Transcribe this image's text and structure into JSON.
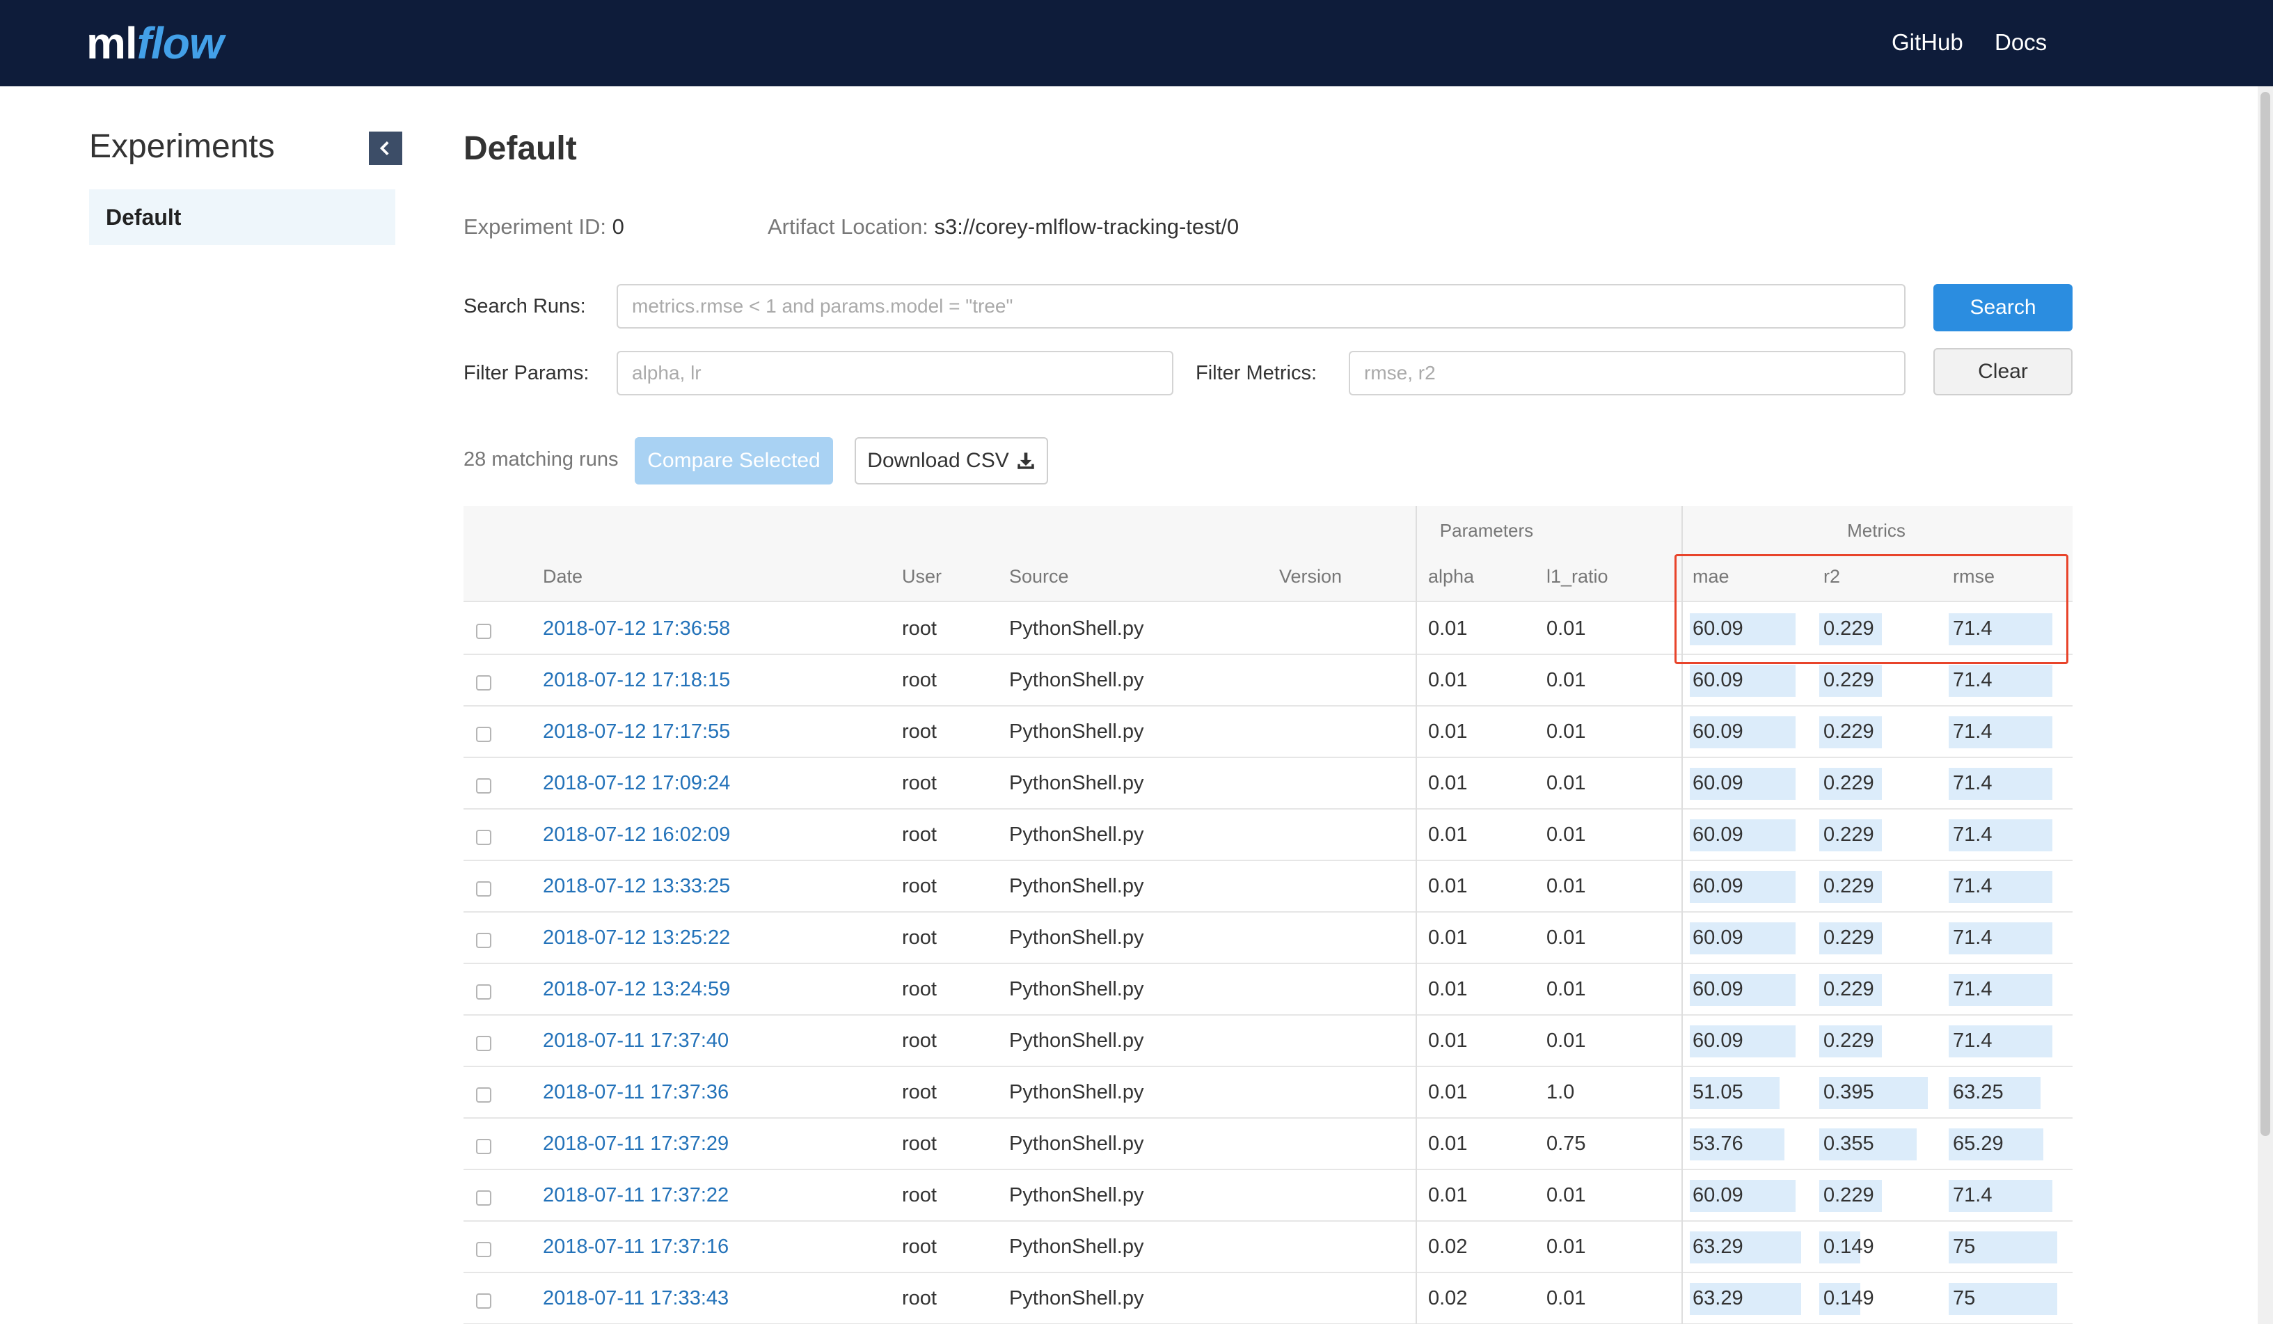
{
  "header": {
    "logo_ml": "ml",
    "logo_flow": "flow",
    "github_label": "GitHub",
    "docs_label": "Docs"
  },
  "sidebar": {
    "title": "Experiments",
    "items": [
      {
        "label": "Default"
      }
    ]
  },
  "main": {
    "title": "Default",
    "experiment_id_label": "Experiment ID:",
    "experiment_id": "0",
    "artifact_location_label": "Artifact Location:",
    "artifact_location": "s3://corey-mlflow-tracking-test/0",
    "search_runs_label": "Search Runs:",
    "search_runs_placeholder": "metrics.rmse < 1 and params.model = \"tree\"",
    "search_button": "Search",
    "filter_params_label": "Filter Params:",
    "filter_params_placeholder": "alpha, lr",
    "filter_metrics_label": "Filter Metrics:",
    "filter_metrics_placeholder": "rmse, r2",
    "clear_button": "Clear",
    "matching_runs": "28 matching runs",
    "compare_button": "Compare Selected",
    "download_button": "Download CSV"
  },
  "table": {
    "group_parameters": "Parameters",
    "group_metrics": "Metrics",
    "columns": {
      "date": "Date",
      "user": "User",
      "source": "Source",
      "version": "Version",
      "alpha": "alpha",
      "l1_ratio": "l1_ratio",
      "mae": "mae",
      "r2": "r2",
      "rmse": "rmse"
    },
    "rows": [
      {
        "date": "2018-07-12 17:36:58",
        "user": "root",
        "source": "PythonShell.py",
        "version": "",
        "alpha": "0.01",
        "l1_ratio": "0.01",
        "mae": "60.09",
        "r2": "0.229",
        "rmse": "71.4"
      },
      {
        "date": "2018-07-12 17:18:15",
        "user": "root",
        "source": "PythonShell.py",
        "version": "",
        "alpha": "0.01",
        "l1_ratio": "0.01",
        "mae": "60.09",
        "r2": "0.229",
        "rmse": "71.4"
      },
      {
        "date": "2018-07-12 17:17:55",
        "user": "root",
        "source": "PythonShell.py",
        "version": "",
        "alpha": "0.01",
        "l1_ratio": "0.01",
        "mae": "60.09",
        "r2": "0.229",
        "rmse": "71.4"
      },
      {
        "date": "2018-07-12 17:09:24",
        "user": "root",
        "source": "PythonShell.py",
        "version": "",
        "alpha": "0.01",
        "l1_ratio": "0.01",
        "mae": "60.09",
        "r2": "0.229",
        "rmse": "71.4"
      },
      {
        "date": "2018-07-12 16:02:09",
        "user": "root",
        "source": "PythonShell.py",
        "version": "",
        "alpha": "0.01",
        "l1_ratio": "0.01",
        "mae": "60.09",
        "r2": "0.229",
        "rmse": "71.4"
      },
      {
        "date": "2018-07-12 13:33:25",
        "user": "root",
        "source": "PythonShell.py",
        "version": "",
        "alpha": "0.01",
        "l1_ratio": "0.01",
        "mae": "60.09",
        "r2": "0.229",
        "rmse": "71.4"
      },
      {
        "date": "2018-07-12 13:25:22",
        "user": "root",
        "source": "PythonShell.py",
        "version": "",
        "alpha": "0.01",
        "l1_ratio": "0.01",
        "mae": "60.09",
        "r2": "0.229",
        "rmse": "71.4"
      },
      {
        "date": "2018-07-12 13:24:59",
        "user": "root",
        "source": "PythonShell.py",
        "version": "",
        "alpha": "0.01",
        "l1_ratio": "0.01",
        "mae": "60.09",
        "r2": "0.229",
        "rmse": "71.4"
      },
      {
        "date": "2018-07-11 17:37:40",
        "user": "root",
        "source": "PythonShell.py",
        "version": "",
        "alpha": "0.01",
        "l1_ratio": "0.01",
        "mae": "60.09",
        "r2": "0.229",
        "rmse": "71.4"
      },
      {
        "date": "2018-07-11 17:37:36",
        "user": "root",
        "source": "PythonShell.py",
        "version": "",
        "alpha": "0.01",
        "l1_ratio": "1.0",
        "mae": "51.05",
        "r2": "0.395",
        "rmse": "63.25"
      },
      {
        "date": "2018-07-11 17:37:29",
        "user": "root",
        "source": "PythonShell.py",
        "version": "",
        "alpha": "0.01",
        "l1_ratio": "0.75",
        "mae": "53.76",
        "r2": "0.355",
        "rmse": "65.29"
      },
      {
        "date": "2018-07-11 17:37:22",
        "user": "root",
        "source": "PythonShell.py",
        "version": "",
        "alpha": "0.01",
        "l1_ratio": "0.01",
        "mae": "60.09",
        "r2": "0.229",
        "rmse": "71.4"
      },
      {
        "date": "2018-07-11 17:37:16",
        "user": "root",
        "source": "PythonShell.py",
        "version": "",
        "alpha": "0.02",
        "l1_ratio": "0.01",
        "mae": "63.29",
        "r2": "0.149",
        "rmse": "75"
      },
      {
        "date": "2018-07-11 17:33:43",
        "user": "root",
        "source": "PythonShell.py",
        "version": "",
        "alpha": "0.02",
        "l1_ratio": "0.01",
        "mae": "63.29",
        "r2": "0.149",
        "rmse": "75"
      }
    ]
  },
  "icons": {
    "collapse": "chevron-left-icon",
    "download": "download-icon",
    "checkbox": "checkbox-icon"
  },
  "colors": {
    "header_bg": "#0e1c3a",
    "accent": "#2b8de0",
    "link": "#2372b9",
    "metric_bar": "#dcecfa",
    "highlight": "#e8442b"
  }
}
